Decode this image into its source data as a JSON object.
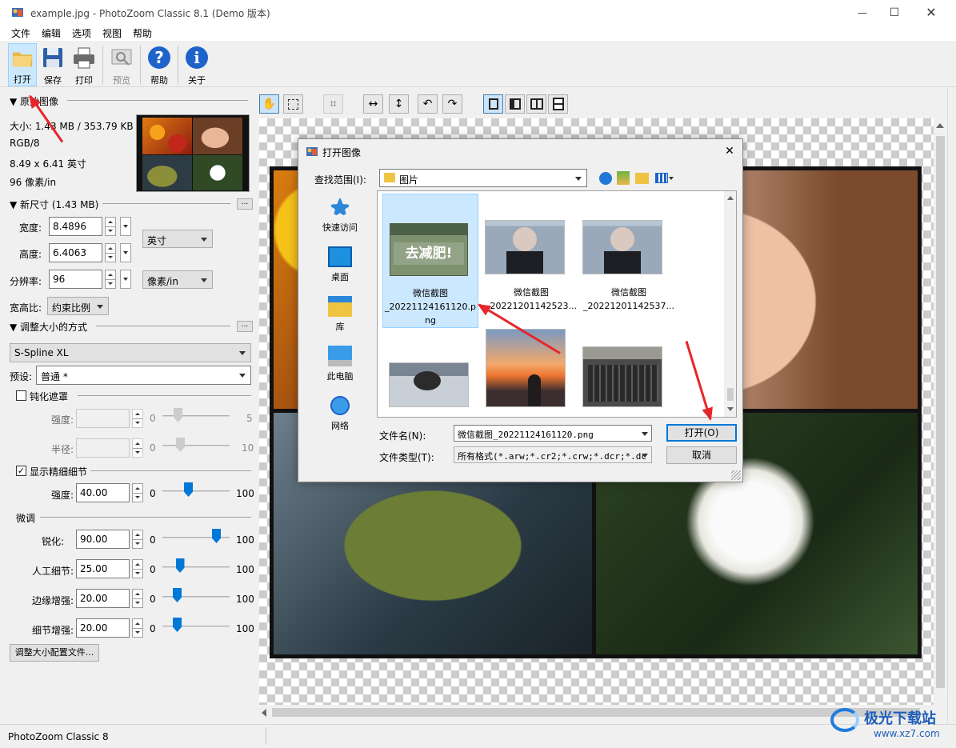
{
  "window": {
    "title": "example.jpg - PhotoZoom Classic 8.1 (Demo 版本)",
    "minimize": "—",
    "maximize": "☐",
    "close": "✕"
  },
  "menu": [
    "文件",
    "编辑",
    "选项",
    "视图",
    "帮助"
  ],
  "toolbar": {
    "open": "打开",
    "save": "保存",
    "print": "打印",
    "preview": "预览",
    "help": "帮助",
    "about": "关于"
  },
  "original": {
    "header": "▼ 原始图像",
    "size": "大小: 1.43 MB / 353.79 KB",
    "mode": "RGB/8",
    "dims": "8.49 x 6.41 英寸",
    "dpi": "96 像素/in"
  },
  "newsize": {
    "header": "▼ 新尺寸 (1.43 MB)",
    "width_label": "宽度:",
    "width": "8.4896",
    "height_label": "高度:",
    "height": "6.4063",
    "res_label": "分辨率:",
    "res": "96",
    "unit": "英寸",
    "res_unit": "像素/in",
    "aspect_label": "宽高比:",
    "aspect": "约束比例",
    "more": "..."
  },
  "method": {
    "header": "▼ 调整大小的方式",
    "algo": "S-Spline XL",
    "preset_label": "预设:",
    "preset": "普通 *",
    "more": "..."
  },
  "unsharp": {
    "label": "钝化遮罩",
    "checked": false,
    "strength_label": "强度:",
    "strength_min": "0",
    "strength_max": "5",
    "radius_label": "半径:",
    "radius_min": "0",
    "radius_max": "10"
  },
  "detail": {
    "label": "显示精细细节",
    "checked": "✓",
    "strength_label": "强度:",
    "strength": "40.00",
    "strength_min": "0",
    "strength_max": "100",
    "strength_level": 0.4
  },
  "fine": {
    "header": "微调",
    "rows": [
      {
        "label": "锐化:",
        "value": "90.00",
        "min": "0",
        "max": "100",
        "level": 0.9
      },
      {
        "label": "人工细节:",
        "value": "25.00",
        "min": "0",
        "max": "100",
        "level": 0.25
      },
      {
        "label": "边缘增强:",
        "value": "20.00",
        "min": "0",
        "max": "100",
        "level": 0.2
      },
      {
        "label": "细节增强:",
        "value": "20.00",
        "min": "0",
        "max": "100",
        "level": 0.2
      }
    ]
  },
  "profile_button": "调整大小配置文件...",
  "status": "PhotoZoom Classic 8",
  "dialog": {
    "title": "打开图像",
    "look_in_label": "查找范围(I):",
    "look_in": "图片",
    "places": [
      "快速访问",
      "桌面",
      "库",
      "此电脑",
      "网络"
    ],
    "files": [
      {
        "name": "微信截图_20221124161120.png",
        "line1": "微信截图",
        "line2": "_20221124161120.p",
        "line3": "ng",
        "thumb_text": "去减肥!"
      },
      {
        "name": "微信截图_20221201142523...",
        "line1": "微信截图",
        "line2": "_20221201142523..."
      },
      {
        "name": "微信截图_20221201142537...",
        "line1": "微信截图",
        "line2": "_20221201142537..."
      }
    ],
    "filename_label": "文件名(N):",
    "filename": "微信截图_20221124161120.png",
    "filetype_label": "文件类型(T):",
    "filetype": "所有格式(*.arw;*.cr2;*.crw;*.dcr;*.dc",
    "open": "打开(O)",
    "cancel": "取消",
    "close": "✕"
  },
  "watermark": {
    "brand": "极光下载站",
    "url": "www.xz7.com"
  }
}
